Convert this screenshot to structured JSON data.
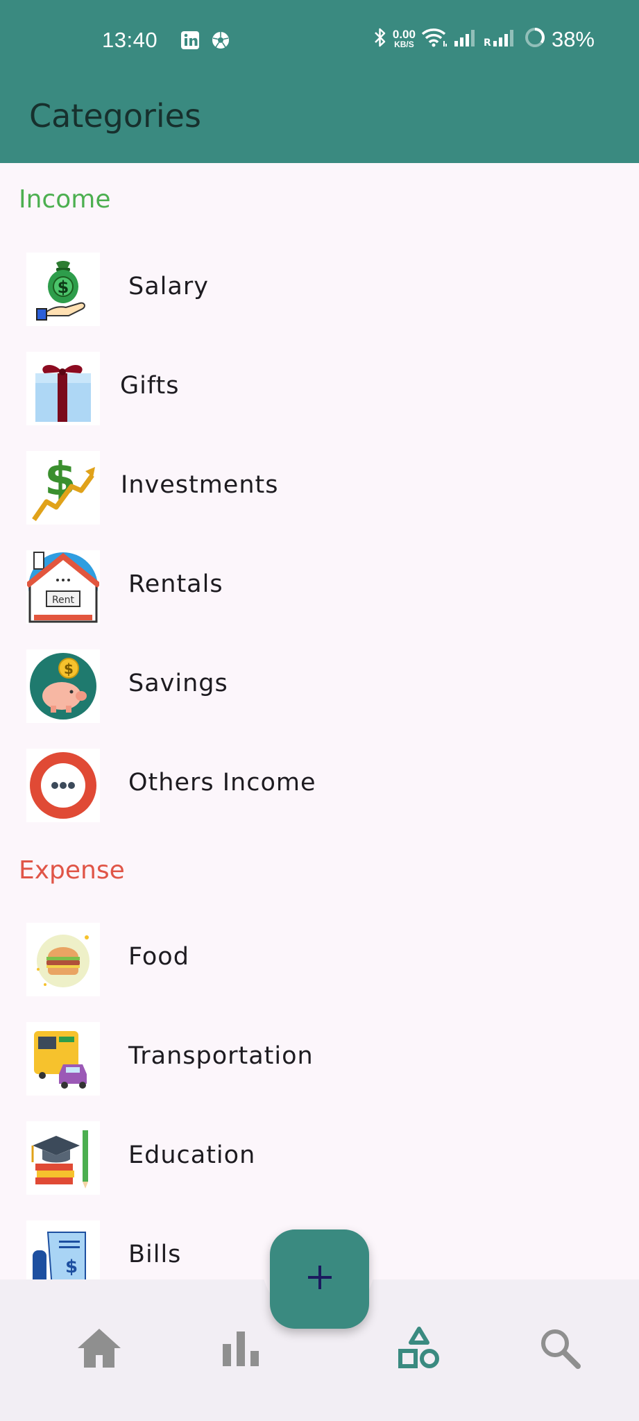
{
  "status_bar": {
    "time": "13:40",
    "net_speed_value": "0.00",
    "net_speed_unit": "KB/S",
    "battery": "38%"
  },
  "app_bar": {
    "title": "Categories"
  },
  "sections": {
    "income": {
      "title": "Income",
      "color": "#4caf50",
      "items": [
        {
          "label": "Salary",
          "icon": "money-bag-hand-icon"
        },
        {
          "label": "Gifts",
          "icon": "gift-box-icon"
        },
        {
          "label": "Investments",
          "icon": "dollar-growth-icon"
        },
        {
          "label": "Rentals",
          "icon": "rent-house-icon"
        },
        {
          "label": "Savings",
          "icon": "piggy-bank-icon"
        },
        {
          "label": "Others Income",
          "icon": "more-dots-icon"
        }
      ]
    },
    "expense": {
      "title": "Expense",
      "color": "#e05547",
      "items": [
        {
          "label": "Food",
          "icon": "burger-icon"
        },
        {
          "label": "Transportation",
          "icon": "bus-car-icon"
        },
        {
          "label": "Education",
          "icon": "graduation-books-icon"
        },
        {
          "label": "Bills",
          "icon": "bill-receipt-icon"
        }
      ]
    }
  },
  "fab": {
    "icon": "plus-icon"
  },
  "bottom_nav": {
    "items": [
      {
        "name": "home",
        "icon": "home-icon",
        "active": false
      },
      {
        "name": "stats",
        "icon": "bar-chart-icon",
        "active": false
      },
      {
        "name": "categories",
        "icon": "shapes-icon",
        "active": true
      },
      {
        "name": "search",
        "icon": "search-icon",
        "active": false
      }
    ]
  },
  "colors": {
    "primary": "#3a8a80",
    "background": "#fcf6fb",
    "nav_background": "#f2eef4",
    "nav_inactive": "#8f8f8f"
  }
}
